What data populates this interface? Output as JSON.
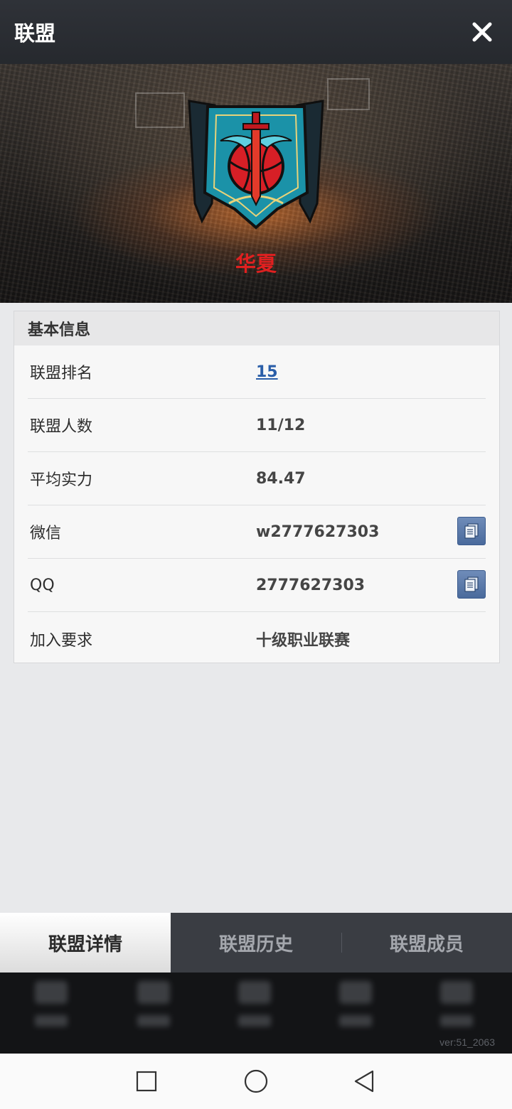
{
  "header": {
    "title": "联盟",
    "close_icon": "close-icon"
  },
  "banner": {
    "alliance_name": "华夏",
    "emblem_icon": "alliance-emblem-shield-sword-icon",
    "name_color": "#e02020"
  },
  "basic_info": {
    "title": "基本信息",
    "rows": [
      {
        "label": "联盟排名",
        "value": "15"
      },
      {
        "label": "联盟人数",
        "value": "11/12"
      },
      {
        "label": "平均实力",
        "value": "84.47"
      },
      {
        "label": "微信",
        "value": "w2777627303"
      },
      {
        "label": "QQ",
        "value": "2777627303"
      },
      {
        "label": "加入要求",
        "value": "十级职业联赛"
      }
    ],
    "link_color": "#2a5ea8"
  },
  "tabs": [
    {
      "label": "联盟详情",
      "active": true
    },
    {
      "label": "联盟历史",
      "active": false
    },
    {
      "label": "联盟成员",
      "active": false
    }
  ],
  "footer": {
    "version": "ver:51_2063"
  },
  "system_nav": {
    "recent_icon": "square-icon",
    "home_icon": "circle-icon",
    "back_icon": "triangle-back-icon"
  }
}
